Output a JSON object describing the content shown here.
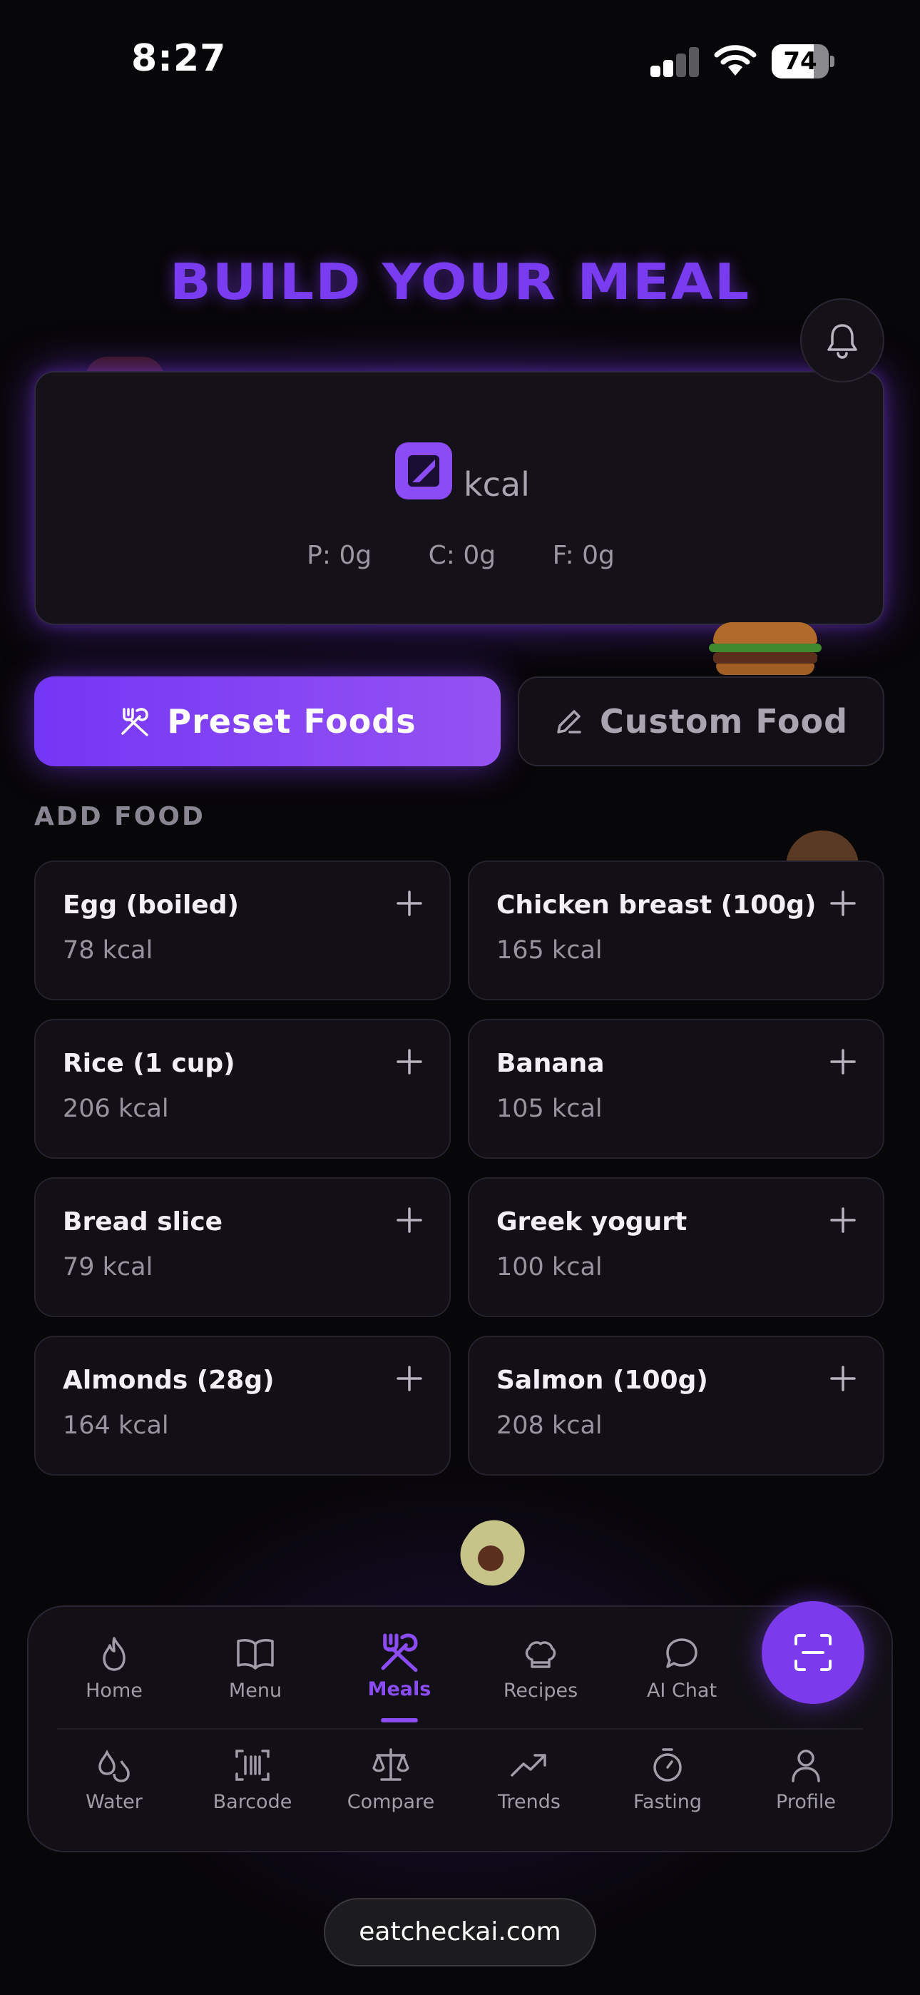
{
  "status_bar": {
    "time": "8:27",
    "battery": "74",
    "battery_level": 0.74
  },
  "header": {
    "title": "BUILD YOUR MEAL",
    "bell_icon": "bell-icon"
  },
  "summary": {
    "kcal_unit": "kcal",
    "macros": {
      "protein": "P: 0g",
      "carbs": "C: 0g",
      "fat": "F: 0g"
    }
  },
  "modes": {
    "preset_label": "Preset Foods",
    "custom_label": "Custom Food"
  },
  "section": {
    "add_food_label": "ADD FOOD"
  },
  "foods": [
    {
      "name": "Egg (boiled)",
      "kcal": "78 kcal"
    },
    {
      "name": "Chicken breast (100g)",
      "kcal": "165 kcal"
    },
    {
      "name": "Rice (1 cup)",
      "kcal": "206 kcal"
    },
    {
      "name": "Banana",
      "kcal": "105 kcal"
    },
    {
      "name": "Bread slice",
      "kcal": "79 kcal"
    },
    {
      "name": "Greek yogurt",
      "kcal": "100 kcal"
    },
    {
      "name": "Almonds (28g)",
      "kcal": "164 kcal"
    },
    {
      "name": "Salmon (100g)",
      "kcal": "208 kcal"
    }
  ],
  "nav": {
    "row1": [
      "Home",
      "Menu",
      "Meals",
      "Recipes",
      "AI Chat"
    ],
    "row2": [
      "Water",
      "Barcode",
      "Compare",
      "Trends",
      "Fasting",
      "Profile"
    ],
    "active": "Meals"
  },
  "footer": {
    "url": "eatcheckai.com"
  },
  "colors": {
    "accent": "#7c3aed",
    "accent_light": "#9553f2",
    "background": "#070608",
    "card": "#121016"
  }
}
